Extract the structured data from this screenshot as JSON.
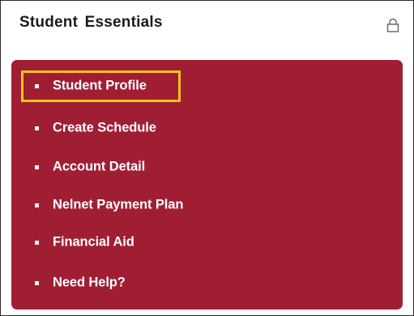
{
  "widget": {
    "title": "Student Essentials",
    "lock_icon": "lock-icon"
  },
  "menu": {
    "items": [
      {
        "label": "Student Profile",
        "highlighted": true
      },
      {
        "label": "Create Schedule",
        "highlighted": false
      },
      {
        "label": "Account Detail",
        "highlighted": false
      },
      {
        "label": "Nelnet Payment Plan",
        "highlighted": false
      },
      {
        "label": "Financial Aid",
        "highlighted": false
      },
      {
        "label": "Need Help?",
        "highlighted": false
      }
    ]
  },
  "colors": {
    "panel": "#a01e34",
    "highlight": "#f5c518",
    "text": "#ffffff",
    "title": "#1b1b1b"
  }
}
